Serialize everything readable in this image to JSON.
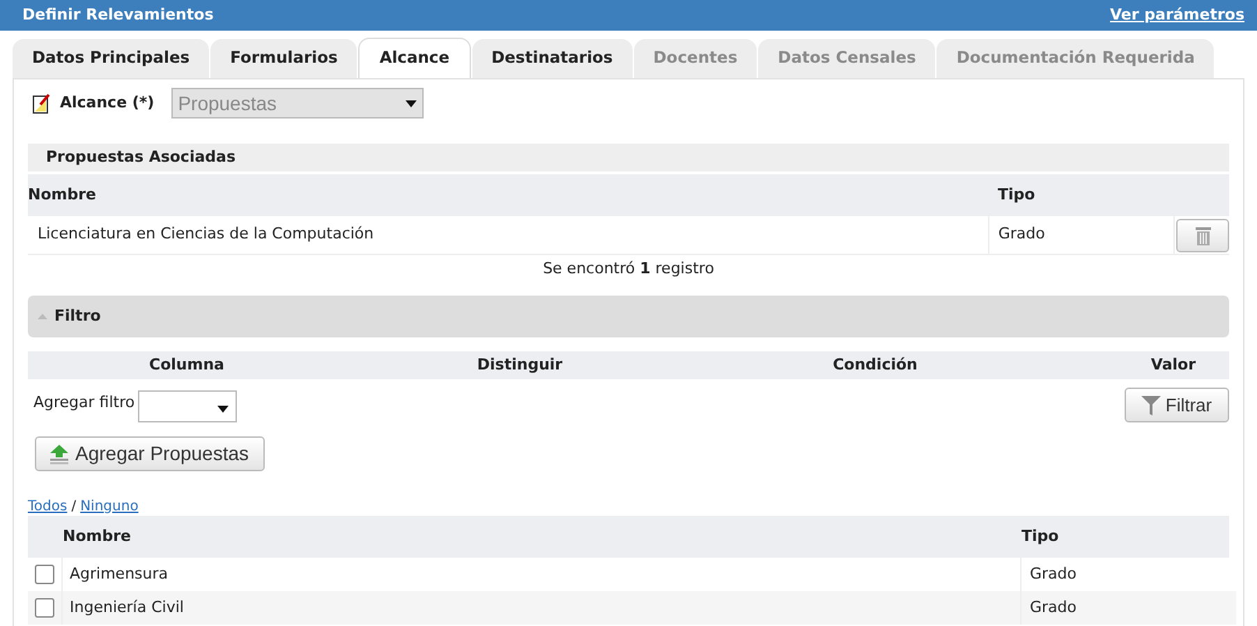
{
  "window": {
    "title": "Definir Relevamientos",
    "link": "Ver parámetros"
  },
  "tabs": [
    {
      "label": "Datos Principales",
      "selected": false,
      "disabled": false
    },
    {
      "label": "Formularios",
      "selected": false,
      "disabled": false
    },
    {
      "label": "Alcance",
      "selected": true,
      "disabled": false
    },
    {
      "label": "Destinatarios",
      "selected": false,
      "disabled": false
    },
    {
      "label": "Docentes",
      "selected": false,
      "disabled": true
    },
    {
      "label": "Datos Censales",
      "selected": false,
      "disabled": true
    },
    {
      "label": "Documentación Requerida",
      "selected": false,
      "disabled": true
    }
  ],
  "alcance": {
    "label": "Alcance (*)",
    "value": "Propuestas",
    "disabled": true
  },
  "propuestas_asociadas": {
    "title": "Propuestas Asociadas",
    "columns": [
      "Nombre",
      "Tipo"
    ],
    "rows": [
      {
        "nombre": "Licenciatura en Ciencias de la Computación",
        "tipo": "Grado"
      }
    ],
    "count_text": "Se encontró **1** registro"
  },
  "filtro": {
    "title": "Filtro",
    "expanded": true,
    "columns": [
      "Columna",
      "Distinguir",
      "Condición",
      "Valor"
    ],
    "add_label": "Agregar filtro",
    "button": "Filtrar"
  },
  "add_button": "Agregar Propuestas",
  "select_links": [
    "Todos",
    "Ninguno"
  ],
  "separator": "/",
  "propuestas": {
    "columns": [
      "Nombre",
      "Tipo"
    ],
    "rows": [
      {
        "nombre": "Agrimensura",
        "tipo": "Grado",
        "checked": false
      },
      {
        "nombre": "Ingeniería Civil",
        "tipo": "Grado",
        "checked": false
      }
    ]
  }
}
